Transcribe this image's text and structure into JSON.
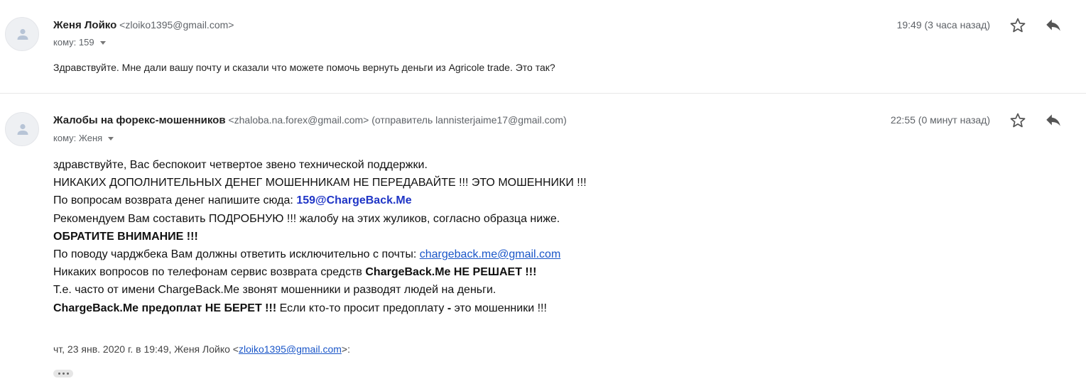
{
  "message1": {
    "sender_name": "Женя Лойко",
    "sender_email": "<zloiko1395@gmail.com>",
    "to_line": "кому: 159",
    "time": "19:49 (3 часа назад)",
    "preview": "Здравствуйте. Мне дали вашу почту и сказали что можете помочь вернуть деньги из Agricole trade. Это так?"
  },
  "message2": {
    "sender_name": "Жалобы на форекс-мошенников",
    "sender_email": "<zhaloba.na.forex@gmail.com>",
    "sender_via": "(отправитель lannisterjaime17@gmail.com)",
    "to_line": "кому: Женя",
    "time": "22:55 (0 минут назад)",
    "body": {
      "l1": "здравствуйте, Вас беспокоит четвертое звено технической поддержки.",
      "l2": "НИКАКИХ ДОПОЛНИТЕЛЬНЫХ ДЕНЕГ МОШЕННИКАМ НЕ ПЕРЕДАВАЙТЕ !!! ЭТО МОШЕННИКИ !!!",
      "l3_text": "По вопросам возврата денег напишите сюда: ",
      "l3_contact": "159@ChargeBack.Me",
      "l4": "Рекомендуем Вам составить ПОДРОБНУЮ !!! жалобу на этих жуликов, согласно образца ниже.",
      "l5": "ОБРАТИТЕ ВНИМАНИЕ !!!",
      "l6_text": "По поводу чарджбека Вам должны ответить исключительно с почты: ",
      "l6_link": "chargeback.me@gmail.com",
      "l7_text": "Никаких вопросов по телефонам сервис возврата средств ",
      "l7_bold": "ChargeBack.Me НЕ РЕШАЕТ !!!",
      "l8": "Т.е. часто от имени ChargeBack.Me звонят мошенники и разводят людей на деньги.",
      "l9_bold": "ChargeBack.Me предоплат НЕ БЕРЕТ !!!",
      "l9_text": " Если кто-то просит предоплату ",
      "l9_dash": "-",
      "l9_tail": " это мошенники !!!"
    },
    "quote": {
      "prefix": "чт, 23 янв. 2020 г. в 19:49, Женя Лойко <",
      "email": "zloiko1395@gmail.com",
      "suffix": ">:"
    }
  },
  "icons": {
    "avatar": "person-icon",
    "star": "star-icon",
    "reply": "reply-icon",
    "more": "ellipsis-icon"
  }
}
